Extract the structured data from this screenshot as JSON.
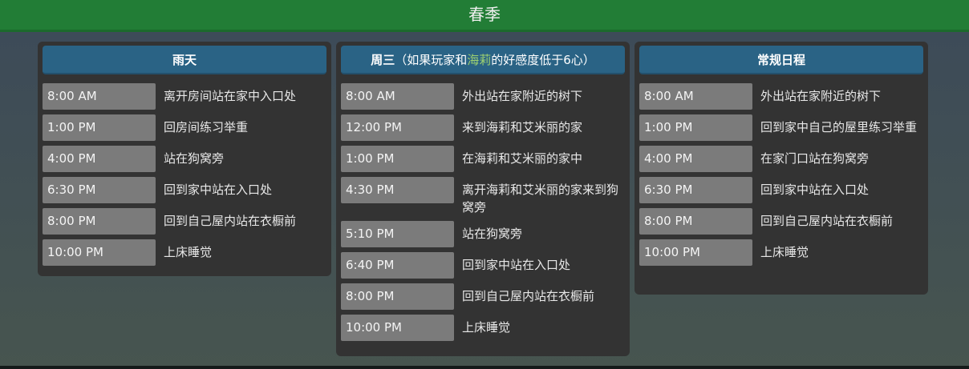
{
  "season": "春季",
  "columns": [
    {
      "title": "雨天",
      "rows": [
        {
          "time": "8:00 AM",
          "desc": "离开房间站在家中入口处"
        },
        {
          "time": "1:00 PM",
          "desc": "回房间练习举重"
        },
        {
          "time": "4:00 PM",
          "desc": "站在狗窝旁"
        },
        {
          "time": "6:30 PM",
          "desc": "回到家中站在入口处"
        },
        {
          "time": "8:00 PM",
          "desc": "回到自己屋内站在衣橱前"
        },
        {
          "time": "10:00 PM",
          "desc": "上床睡觉"
        }
      ]
    },
    {
      "title_main": "周三",
      "title_pre": "（如果玩家和",
      "title_highlight": "海莉",
      "title_post": "的好感度低于6心）",
      "rows": [
        {
          "time": "8:00 AM",
          "desc": "外出站在家附近的树下"
        },
        {
          "time": "12:00 PM",
          "desc": "来到海莉和艾米丽的家"
        },
        {
          "time": "1:00 PM",
          "desc": "在海莉和艾米丽的家中"
        },
        {
          "time": "4:30 PM",
          "desc": "离开海莉和艾米丽的家来到狗窝旁"
        },
        {
          "time": "5:10 PM",
          "desc": "站在狗窝旁"
        },
        {
          "time": "6:40 PM",
          "desc": "回到家中站在入口处"
        },
        {
          "time": "8:00 PM",
          "desc": "回到自己屋内站在衣橱前"
        },
        {
          "time": "10:00 PM",
          "desc": "上床睡觉"
        }
      ]
    },
    {
      "title": "常规日程",
      "rows": [
        {
          "time": "8:00 AM",
          "desc": "外出站在家附近的树下"
        },
        {
          "time": "1:00 PM",
          "desc": "回到家中自己的屋里练习举重"
        },
        {
          "time": "4:00 PM",
          "desc": "在家门口站在狗窝旁"
        },
        {
          "time": "6:30 PM",
          "desc": "回到家中站在入口处"
        },
        {
          "time": "8:00 PM",
          "desc": "回到自己屋内站在衣橱前"
        },
        {
          "time": "10:00 PM",
          "desc": "上床睡觉"
        }
      ]
    }
  ],
  "colors": {
    "header_green": "#227d36",
    "card_title_blue": "#2a6385",
    "time_cell_gray": "#7b7b7b",
    "highlight_green": "#9dd070"
  }
}
